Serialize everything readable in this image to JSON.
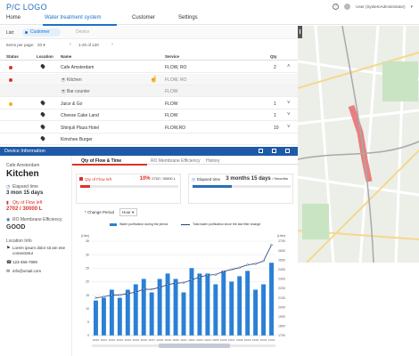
{
  "app": {
    "logo": "P/C LOGO",
    "user": "User (SystemAdministrator)"
  },
  "nav": {
    "tabs": [
      "Home",
      "Water treatment system",
      "Customer",
      "Settings"
    ],
    "active": "Water treatment system"
  },
  "list": {
    "label": "List:",
    "chips": {
      "customer": "Customer",
      "device": "Device"
    },
    "items_per_page_label": "Items per page:",
    "items_per_page": "20",
    "range": "1-20 of 120",
    "columns": [
      "Status",
      "Location",
      "Name",
      "Service",
      "Qty"
    ],
    "rows": [
      {
        "status": "#d9342b",
        "name": "Cafe Amsterdam",
        "service": "FLOW, RO",
        "qty": "2",
        "expanded": true
      },
      {
        "sub": true,
        "status": "#d9342b",
        "name": "Kitchen",
        "service": "FLOW, RO",
        "selected": true
      },
      {
        "sub": true,
        "name": "Bar counter",
        "service": "FLOW"
      },
      {
        "status": "#f2b21b",
        "name": "Juice & Go",
        "service": "FLOW",
        "qty": "1"
      },
      {
        "name": "Cheese Cake Land",
        "service": "FLOW",
        "qty": "1"
      },
      {
        "name": "Shinjuli Plaza Hotel",
        "service": "FLOW,RO",
        "qty": "10"
      },
      {
        "name": "Kimchee Burger",
        "service": "",
        "qty": ""
      }
    ]
  },
  "device": {
    "panel_title": "Device Information",
    "customer": "Cafe Amsterdam",
    "name": "Kitchen",
    "elapsed_label": "Elapsed time",
    "elapsed_value": "3 mon 15 days",
    "qty_left_label": "Qty of Flow left",
    "qty_left_value": "2702 / 30000 L",
    "ro_label": "RO Membrane Efficiency",
    "ro_value": "GOOD",
    "location_label": "Location Info",
    "address": "Lorem ipsum dolor sit am ese consectetur",
    "phone": "123-456-7890",
    "email": "info@xmail.com",
    "tabs": [
      "Qty of Flow & Time",
      "RO Membrane Efficiency",
      "History"
    ],
    "card_qty": {
      "title": "Qty of Flow left",
      "pct": "10%",
      "detail": "2702 / 30000 L",
      "fill": 0.1,
      "color": "#d9342b"
    },
    "card_time": {
      "title": "Elapsed time",
      "value": "3 months 15 days",
      "detail": "/ 9months",
      "fill": 0.4,
      "color": "#2a6db8"
    },
    "change_period_label": "* Change Period",
    "period": "Hour",
    "legend_bar": "Water purification during the period",
    "legend_line": "Total water purification since the last filter change"
  },
  "chart_data": {
    "type": "bar",
    "categories": [
      "10/10",
      "10/11",
      "10/12",
      "10/13",
      "10/14",
      "10/15",
      "10/16",
      "10/17",
      "10/18",
      "10/19",
      "10/20",
      "10/21",
      "10/22",
      "10/23",
      "10/24",
      "10/25",
      "10/26",
      "10/27",
      "10/28",
      "10/29",
      "10/30",
      "10/31",
      "11/01"
    ],
    "series": [
      {
        "name": "Water purification during the period",
        "type": "bar",
        "axis": "left",
        "values": [
          13,
          14,
          17,
          14,
          17,
          19,
          21,
          16,
          21,
          23,
          21,
          16,
          25,
          23,
          23,
          19,
          24,
          20,
          22,
          24,
          17,
          19,
          27
        ]
      },
      {
        "name": "Total water purification since the last filter change",
        "type": "line",
        "axis": "right",
        "values": [
          2100,
          2110,
          2130,
          2130,
          2145,
          2160,
          2190,
          2190,
          2210,
          2240,
          2255,
          2260,
          2290,
          2320,
          2340,
          2345,
          2380,
          2400,
          2420,
          2450,
          2460,
          2490,
          2660
        ]
      }
    ],
    "ylabel_left": "(Liter)",
    "ylabel_right": "(Liter)",
    "ylim_left": [
      0,
      35
    ],
    "ylim_right": [
      1700,
      2700
    ],
    "yticks_left": [
      0,
      5,
      10,
      15,
      20,
      25,
      30,
      35
    ],
    "yticks_right": [
      1700,
      1800,
      1900,
      2000,
      2100,
      2200,
      2300,
      2400,
      2500,
      2600,
      2700
    ],
    "grid": true
  },
  "colors": {
    "accent": "#1a73c8",
    "danger": "#d9342b",
    "warning": "#f2b21b",
    "panel": "#1e5aa8"
  }
}
